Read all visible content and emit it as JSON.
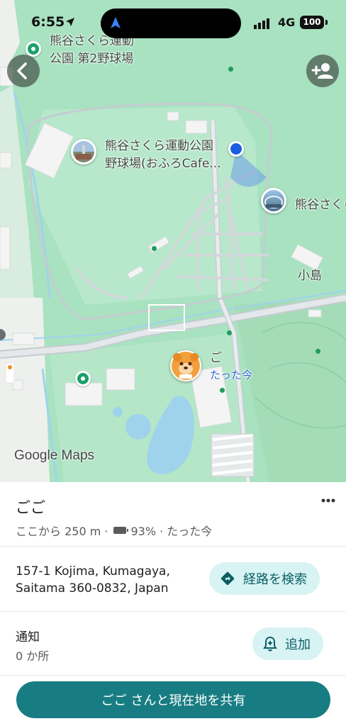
{
  "status_bar": {
    "time": "6:55",
    "network": "4G",
    "battery": "100"
  },
  "map": {
    "labels": {
      "park_line1": "熊谷さくら運動",
      "park_line2": "公園 第2野球場",
      "stadium_line1": "熊谷さくら運動公園",
      "stadium_line2": "野球場(おふろCafe...",
      "poi_right": "熊谷さくら",
      "district": "小島",
      "person_short": "ご",
      "person_time": "たった今"
    },
    "logo": "Google Maps"
  },
  "sheet": {
    "name": "ごご",
    "distance": "ここから 250 m ·",
    "battery": "93% · たった今",
    "address_line1": "157-1 Kojima, Kumagaya,",
    "address_line2": "Saitama 360-0832, Japan",
    "route_label": "経路を検索",
    "notify_label": "通知",
    "notify_count": "0 か所",
    "add_label": "追加",
    "share_label": "ごご さんと現在地を共有"
  },
  "colors": {
    "accent": "#187d82",
    "pill_bg": "#d8f3f4",
    "map_park": "#a8e2c0",
    "water": "#9fd3ec"
  }
}
